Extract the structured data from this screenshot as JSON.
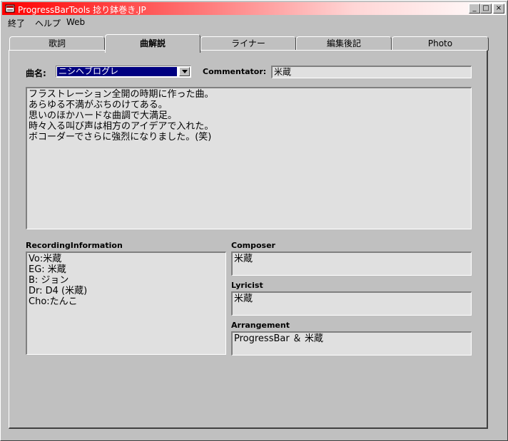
{
  "window": {
    "title": "ProgressBarTools  捻り鉢巻き.JP"
  },
  "caption_buttons": {
    "minimize": "_",
    "maximize": "□",
    "close": "×"
  },
  "menu": [
    "終了",
    "ヘルプ",
    "Web"
  ],
  "tabs": [
    "歌詞",
    "曲解説",
    "ライナー",
    "編集後記",
    "Photo"
  ],
  "active_tab": "曲解説",
  "song": {
    "label": "曲名:",
    "value": "ニシヘブログレ"
  },
  "commentator": {
    "label": "Commentator:",
    "value": "米蔵"
  },
  "commentary": "フラストレーション全開の時期に作った曲。\nあらゆる不満がぶちのけてある。\n思いのほかハードな曲調で大満足。\n時々入る叫び声は相方のアイデアで入れた。\nボコーダーでさらに強烈になりました。(笑)",
  "recording": {
    "label": "RecordingInformation",
    "value": "Vo:米蔵\nEG: 米蔵\nB: ジョン\nDr: D4 (米蔵)\nCho:たんこ"
  },
  "composer": {
    "label": "Composer",
    "value": "米蔵"
  },
  "lyricist": {
    "label": "Lyricist",
    "value": "米蔵"
  },
  "arrangement": {
    "label": "Arrangement",
    "value": "ProgressBar ＆ 米蔵"
  },
  "colors": {
    "title_start": "#ff0000",
    "title_end": "#ffffff",
    "selection": "#000080",
    "face": "#c0c0c0",
    "field": "#e0e0e0"
  }
}
